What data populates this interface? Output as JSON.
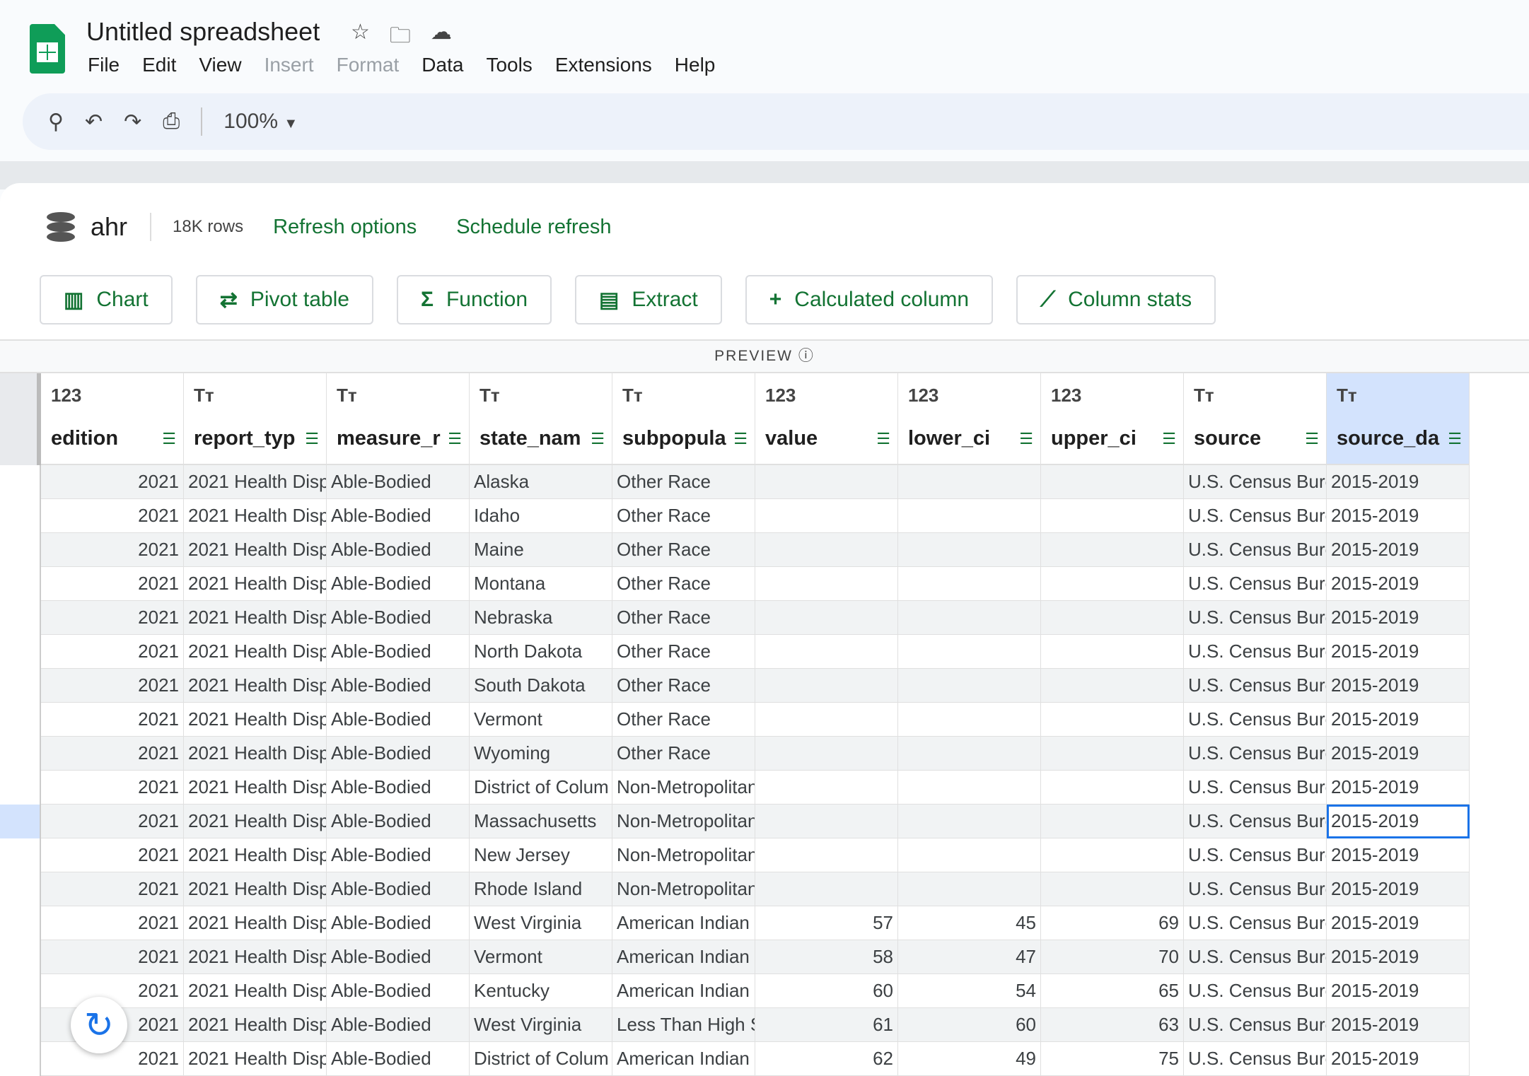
{
  "app": {
    "title": "Untitled spreadsheet",
    "menu": [
      {
        "label": "File",
        "enabled": true
      },
      {
        "label": "Edit",
        "enabled": true
      },
      {
        "label": "View",
        "enabled": true
      },
      {
        "label": "Insert",
        "enabled": false
      },
      {
        "label": "Format",
        "enabled": false
      },
      {
        "label": "Data",
        "enabled": true
      },
      {
        "label": "Tools",
        "enabled": true
      },
      {
        "label": "Extensions",
        "enabled": true
      },
      {
        "label": "Help",
        "enabled": true
      }
    ]
  },
  "toolbar": {
    "zoom": "100%"
  },
  "source": {
    "name": "ahr",
    "rows": "18K rows",
    "refresh_options": "Refresh options",
    "schedule_refresh": "Schedule refresh"
  },
  "actions": [
    {
      "label": "Chart",
      "icon": "chart-icon",
      "glyph": "▥"
    },
    {
      "label": "Pivot table",
      "icon": "pivot-table-icon",
      "glyph": "⇄"
    },
    {
      "label": "Function",
      "icon": "sigma-icon",
      "glyph": "Σ"
    },
    {
      "label": "Extract",
      "icon": "extract-table-icon",
      "glyph": "▤"
    },
    {
      "label": "Calculated column",
      "icon": "plus-icon",
      "glyph": "+"
    },
    {
      "label": "Column stats",
      "icon": "column-stats-icon",
      "glyph": "⟋"
    }
  ],
  "preview_label": "PREVIEW",
  "columns": [
    {
      "type": "123",
      "name": "edition"
    },
    {
      "type": "Tт",
      "name": "report_typ"
    },
    {
      "type": "Tт",
      "name": "measure_r"
    },
    {
      "type": "Tт",
      "name": "state_nam"
    },
    {
      "type": "Tт",
      "name": "subpopula"
    },
    {
      "type": "123",
      "name": "value"
    },
    {
      "type": "123",
      "name": "lower_ci"
    },
    {
      "type": "123",
      "name": "upper_ci"
    },
    {
      "type": "Tт",
      "name": "source"
    },
    {
      "type": "Tт",
      "name": "source_da"
    }
  ],
  "numeric_columns": [
    0,
    5,
    6,
    7
  ],
  "selected_column": 9,
  "selected_row": 10,
  "rows": [
    [
      "2021",
      "2021 Health Disp",
      "Able-Bodied",
      "Alaska",
      "Other Race",
      "",
      "",
      "",
      "U.S. Census Bure",
      "2015-2019"
    ],
    [
      "2021",
      "2021 Health Disp",
      "Able-Bodied",
      "Idaho",
      "Other Race",
      "",
      "",
      "",
      "U.S. Census Bure",
      "2015-2019"
    ],
    [
      "2021",
      "2021 Health Disp",
      "Able-Bodied",
      "Maine",
      "Other Race",
      "",
      "",
      "",
      "U.S. Census Bure",
      "2015-2019"
    ],
    [
      "2021",
      "2021 Health Disp",
      "Able-Bodied",
      "Montana",
      "Other Race",
      "",
      "",
      "",
      "U.S. Census Bure",
      "2015-2019"
    ],
    [
      "2021",
      "2021 Health Disp",
      "Able-Bodied",
      "Nebraska",
      "Other Race",
      "",
      "",
      "",
      "U.S. Census Bure",
      "2015-2019"
    ],
    [
      "2021",
      "2021 Health Disp",
      "Able-Bodied",
      "North Dakota",
      "Other Race",
      "",
      "",
      "",
      "U.S. Census Bure",
      "2015-2019"
    ],
    [
      "2021",
      "2021 Health Disp",
      "Able-Bodied",
      "South Dakota",
      "Other Race",
      "",
      "",
      "",
      "U.S. Census Bure",
      "2015-2019"
    ],
    [
      "2021",
      "2021 Health Disp",
      "Able-Bodied",
      "Vermont",
      "Other Race",
      "",
      "",
      "",
      "U.S. Census Bure",
      "2015-2019"
    ],
    [
      "2021",
      "2021 Health Disp",
      "Able-Bodied",
      "Wyoming",
      "Other Race",
      "",
      "",
      "",
      "U.S. Census Bure",
      "2015-2019"
    ],
    [
      "2021",
      "2021 Health Disp",
      "Able-Bodied",
      "District of Colum",
      "Non-Metropolitan Area",
      "",
      "",
      "",
      "U.S. Census Bure",
      "2015-2019"
    ],
    [
      "2021",
      "2021 Health Disp",
      "Able-Bodied",
      "Massachusetts",
      "Non-Metropolitan Area",
      "",
      "",
      "",
      "U.S. Census Bure",
      "2015-2019"
    ],
    [
      "2021",
      "2021 Health Disp",
      "Able-Bodied",
      "New Jersey",
      "Non-Metropolitan Area",
      "",
      "",
      "",
      "U.S. Census Bure",
      "2015-2019"
    ],
    [
      "2021",
      "2021 Health Disp",
      "Able-Bodied",
      "Rhode Island",
      "Non-Metropolitan Area",
      "",
      "",
      "",
      "U.S. Census Bure",
      "2015-2019"
    ],
    [
      "2021",
      "2021 Health Disp",
      "Able-Bodied",
      "West Virginia",
      "American Indian",
      "57",
      "45",
      "69",
      "U.S. Census Bure",
      "2015-2019"
    ],
    [
      "2021",
      "2021 Health Disp",
      "Able-Bodied",
      "Vermont",
      "American Indian",
      "58",
      "47",
      "70",
      "U.S. Census Bure",
      "2015-2019"
    ],
    [
      "2021",
      "2021 Health Disp",
      "Able-Bodied",
      "Kentucky",
      "American Indian",
      "60",
      "54",
      "65",
      "U.S. Census Bure",
      "2015-2019"
    ],
    [
      "2021",
      "2021 Health Disp",
      "Able-Bodied",
      "West Virginia",
      "Less Than High S",
      "61",
      "60",
      "63",
      "U.S. Census Bure",
      "2015-2019"
    ],
    [
      "2021",
      "2021 Health Disp",
      "Able-Bodied",
      "District of Colum",
      "American Indian",
      "62",
      "49",
      "75",
      "U.S. Census Bure",
      "2015-2019"
    ]
  ],
  "colors": {
    "accent": "#137333",
    "selection": "#1a73e8",
    "selected_header": "#d3e3fd"
  }
}
